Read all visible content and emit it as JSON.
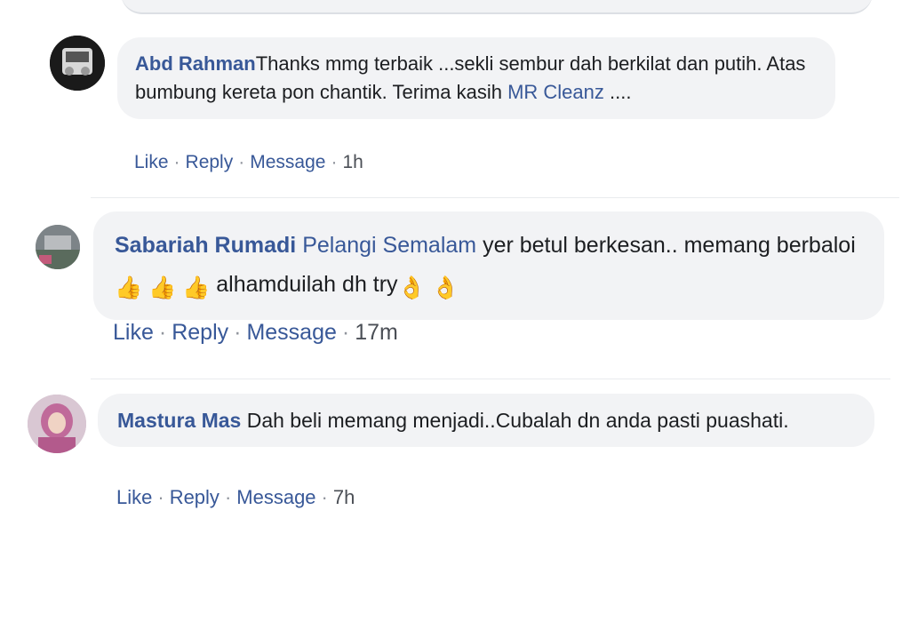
{
  "comments": [
    {
      "author": "Abd Rahman",
      "text_before": "Thanks mmg terbaik ...sekli sembur dah berkilat dan putih. Atas bumbung kereta pon chantik. Terima kasih ",
      "mention": "MR Cleanz",
      "text_after": " ....",
      "actions": {
        "like": "Like",
        "reply": "Reply",
        "message": "Message",
        "separator": "·"
      },
      "time": "1h"
    },
    {
      "author": "Sabariah Rumadi",
      "mention": "Pelangi Semalam",
      "text_part1": " yer betul berkesan.. memang berbaloi",
      "text_part2": " alhamduilah dh try",
      "emojis_thumbs": [
        "👍",
        "👍",
        "👍"
      ],
      "emojis_ok": [
        "👌",
        "👌"
      ],
      "actions": {
        "like": "Like",
        "reply": "Reply",
        "message": "Message",
        "separator": "·"
      },
      "time": "17m"
    },
    {
      "author": "Mastura Mas",
      "text": "Dah beli memang menjadi..Cubalah dn anda pasti puashati.",
      "actions": {
        "like": "Like",
        "reply": "Reply",
        "message": "Message",
        "separator": "·"
      },
      "time": "7h"
    }
  ],
  "colors": {
    "author": "#385898",
    "bubble_bg": "#f2f3f5",
    "text": "#1c1e21",
    "meta": "#4b4f56"
  }
}
